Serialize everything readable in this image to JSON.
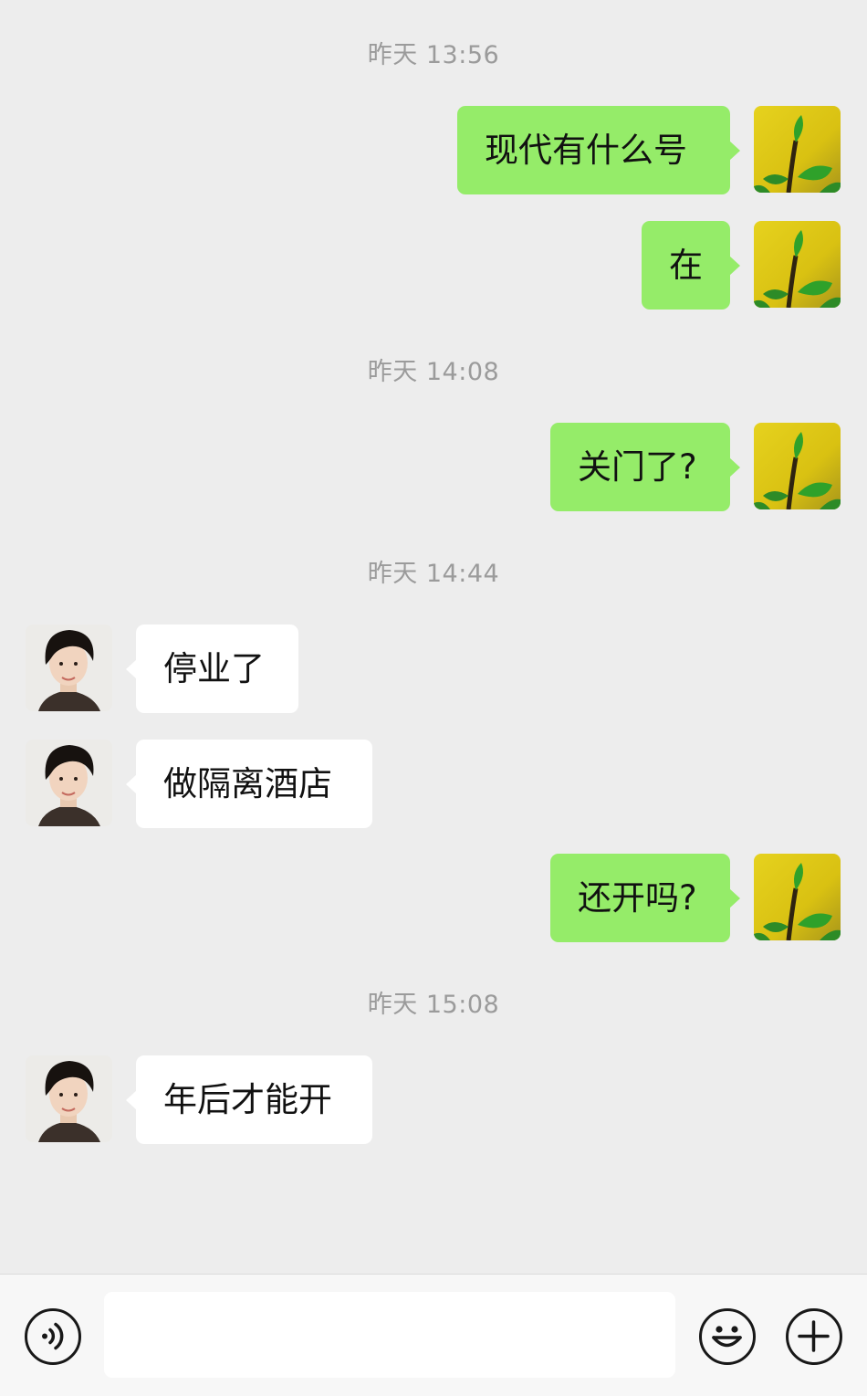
{
  "messages": [
    {
      "type": "time",
      "text": "昨天 13:56"
    },
    {
      "type": "msg",
      "side": "out",
      "text": "现代有什么号"
    },
    {
      "type": "msg",
      "side": "out",
      "text": "在"
    },
    {
      "type": "time",
      "text": "昨天 14:08"
    },
    {
      "type": "msg",
      "side": "out",
      "text": "关门了?"
    },
    {
      "type": "time",
      "text": "昨天 14:44"
    },
    {
      "type": "msg",
      "side": "in",
      "text": "停业了"
    },
    {
      "type": "msg",
      "side": "in",
      "text": "做隔离酒店"
    },
    {
      "type": "msg",
      "side": "out",
      "text": "还开吗?"
    },
    {
      "type": "time",
      "text": "昨天 15:08"
    },
    {
      "type": "msg",
      "side": "in",
      "text": "年后才能开"
    }
  ],
  "input_bar": {
    "voice_icon": "voice-icon",
    "text_value": "",
    "emoji_icon": "emoji-icon",
    "plus_icon": "plus-icon"
  },
  "colors": {
    "background": "#ededed",
    "outgoing_bubble": "#95ec69",
    "incoming_bubble": "#ffffff",
    "timestamp_text": "#9b9b9b",
    "input_bar": "#f7f7f7"
  }
}
